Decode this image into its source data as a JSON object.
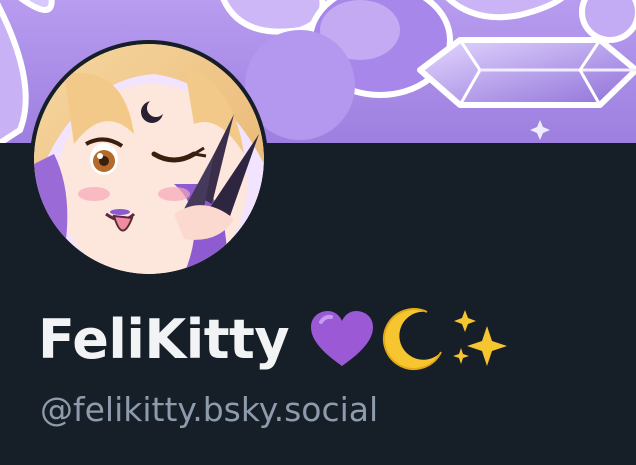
{
  "profile": {
    "display_name": "FeliKitty",
    "handle": "@felikitty.bsky.social",
    "name_emojis": [
      "purple-heart",
      "crescent-moon",
      "sparkles"
    ]
  },
  "colors": {
    "background": "#161e27",
    "banner_purple": "#a98ae6",
    "name_text": "#f1f3f5",
    "handle_text": "#8d9bad"
  }
}
